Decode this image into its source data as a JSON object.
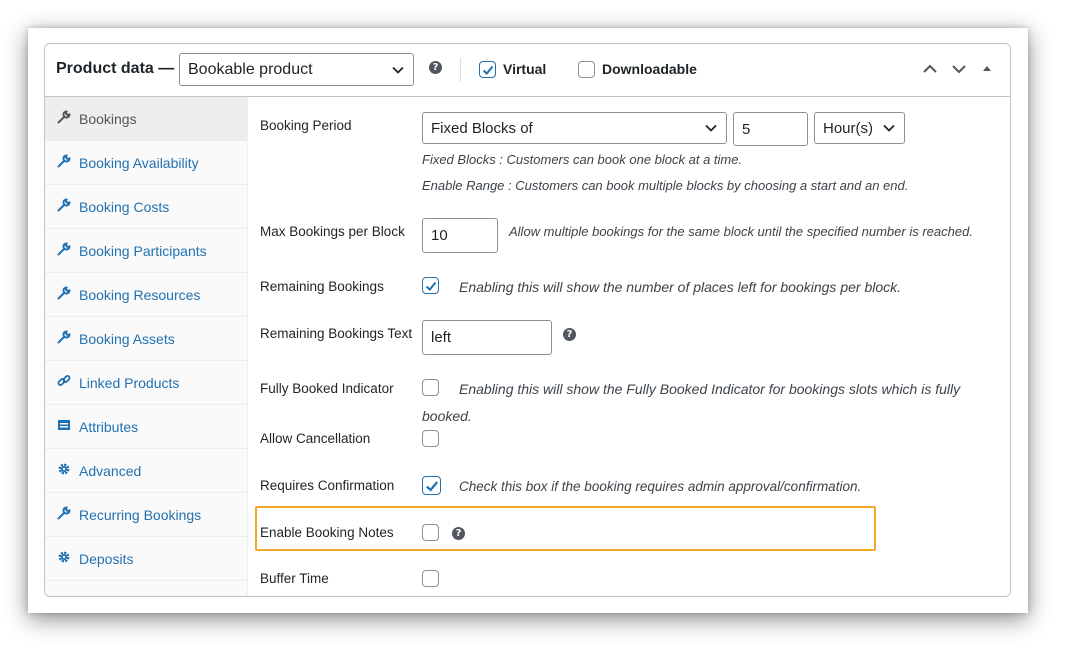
{
  "header": {
    "title": "Product data —",
    "product_type": "Bookable product",
    "virtual_label": "Virtual",
    "virtual_checked": true,
    "downloadable_label": "Downloadable",
    "downloadable_checked": false,
    "help_glyph": "?"
  },
  "sidebar": {
    "items": [
      {
        "label": "Bookings",
        "icon": "wrench-icon",
        "active": true
      },
      {
        "label": "Booking Availability",
        "icon": "wrench-icon"
      },
      {
        "label": "Booking Costs",
        "icon": "wrench-icon"
      },
      {
        "label": "Booking Participants",
        "icon": "wrench-icon"
      },
      {
        "label": "Booking Resources",
        "icon": "wrench-icon"
      },
      {
        "label": "Booking Assets",
        "icon": "wrench-icon"
      },
      {
        "label": "Linked Products",
        "icon": "link-icon"
      },
      {
        "label": "Attributes",
        "icon": "table-icon"
      },
      {
        "label": "Advanced",
        "icon": "gear-icon"
      },
      {
        "label": "Recurring Bookings",
        "icon": "wrench-icon"
      },
      {
        "label": "Deposits",
        "icon": "gear-icon"
      }
    ]
  },
  "form": {
    "booking_period": {
      "label": "Booking Period",
      "type_value": "Fixed Blocks of",
      "amount_value": "5",
      "unit_value": "Hour(s)",
      "desc1": "Fixed Blocks : Customers can book one block at a time.",
      "desc2": "Enable Range : Customers can book multiple blocks by choosing a start and an end."
    },
    "max_bookings": {
      "label": "Max Bookings per Block",
      "value": "10",
      "desc": "Allow multiple bookings for the same block until the specified number is reached."
    },
    "remaining_bookings": {
      "label": "Remaining Bookings",
      "checked": true,
      "desc": "Enabling this will show the number of places left for bookings per block."
    },
    "remaining_text": {
      "label": "Remaining Bookings Text",
      "value": "left"
    },
    "fully_booked": {
      "label": "Fully Booked Indicator",
      "checked": false,
      "desc_line1": "Enabling this will show the Fully Booked Indicator for bookings slots which is fully",
      "desc_line2": "booked."
    },
    "allow_cancellation": {
      "label": "Allow Cancellation",
      "checked": false
    },
    "requires_confirmation": {
      "label": "Requires Confirmation",
      "checked": true,
      "desc": "Check this box if the booking requires admin approval/confirmation."
    },
    "booking_notes": {
      "label": "Enable Booking Notes",
      "checked": false
    },
    "buffer_time": {
      "label": "Buffer Time",
      "checked": false
    }
  },
  "colors": {
    "link": "#2271b1",
    "highlight": "#f0a92a",
    "checkbox_check": "#2271b1"
  }
}
